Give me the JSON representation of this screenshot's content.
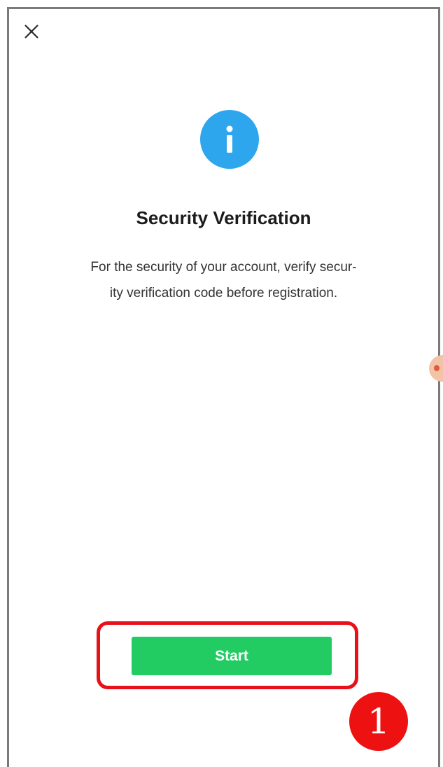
{
  "dialog": {
    "close_icon": "close-icon",
    "info_icon": "info-icon",
    "title": "Security Verification",
    "description_line1": "For the security of your account, verify secur-",
    "description_line2": "ity verification code before registration.",
    "start_label": "Start"
  },
  "annotation": {
    "step_number": "1"
  },
  "colors": {
    "info_blue": "#2ea6ee",
    "start_green": "#22cc63",
    "highlight_red": "#e8111a",
    "badge_red": "#ee1111"
  }
}
